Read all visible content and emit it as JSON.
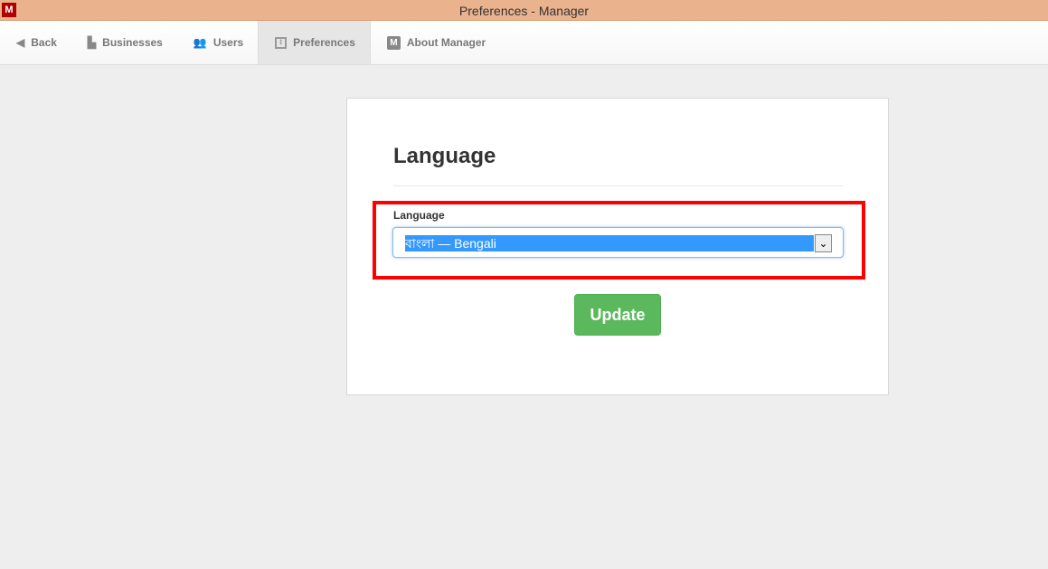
{
  "window": {
    "title": "Preferences - Manager",
    "app_icon": "M"
  },
  "nav": {
    "back": "Back",
    "businesses": "Businesses",
    "users": "Users",
    "preferences": "Preferences",
    "about": "About Manager",
    "about_icon": "M"
  },
  "form": {
    "heading": "Language",
    "field_label": "Language",
    "selected": "বাংলা — Bengali",
    "update_label": "Update"
  },
  "colors": {
    "titlebar": "#ebb38d",
    "button": "#5cb85c",
    "highlight": "#ff0000",
    "selection": "#3399ff"
  }
}
